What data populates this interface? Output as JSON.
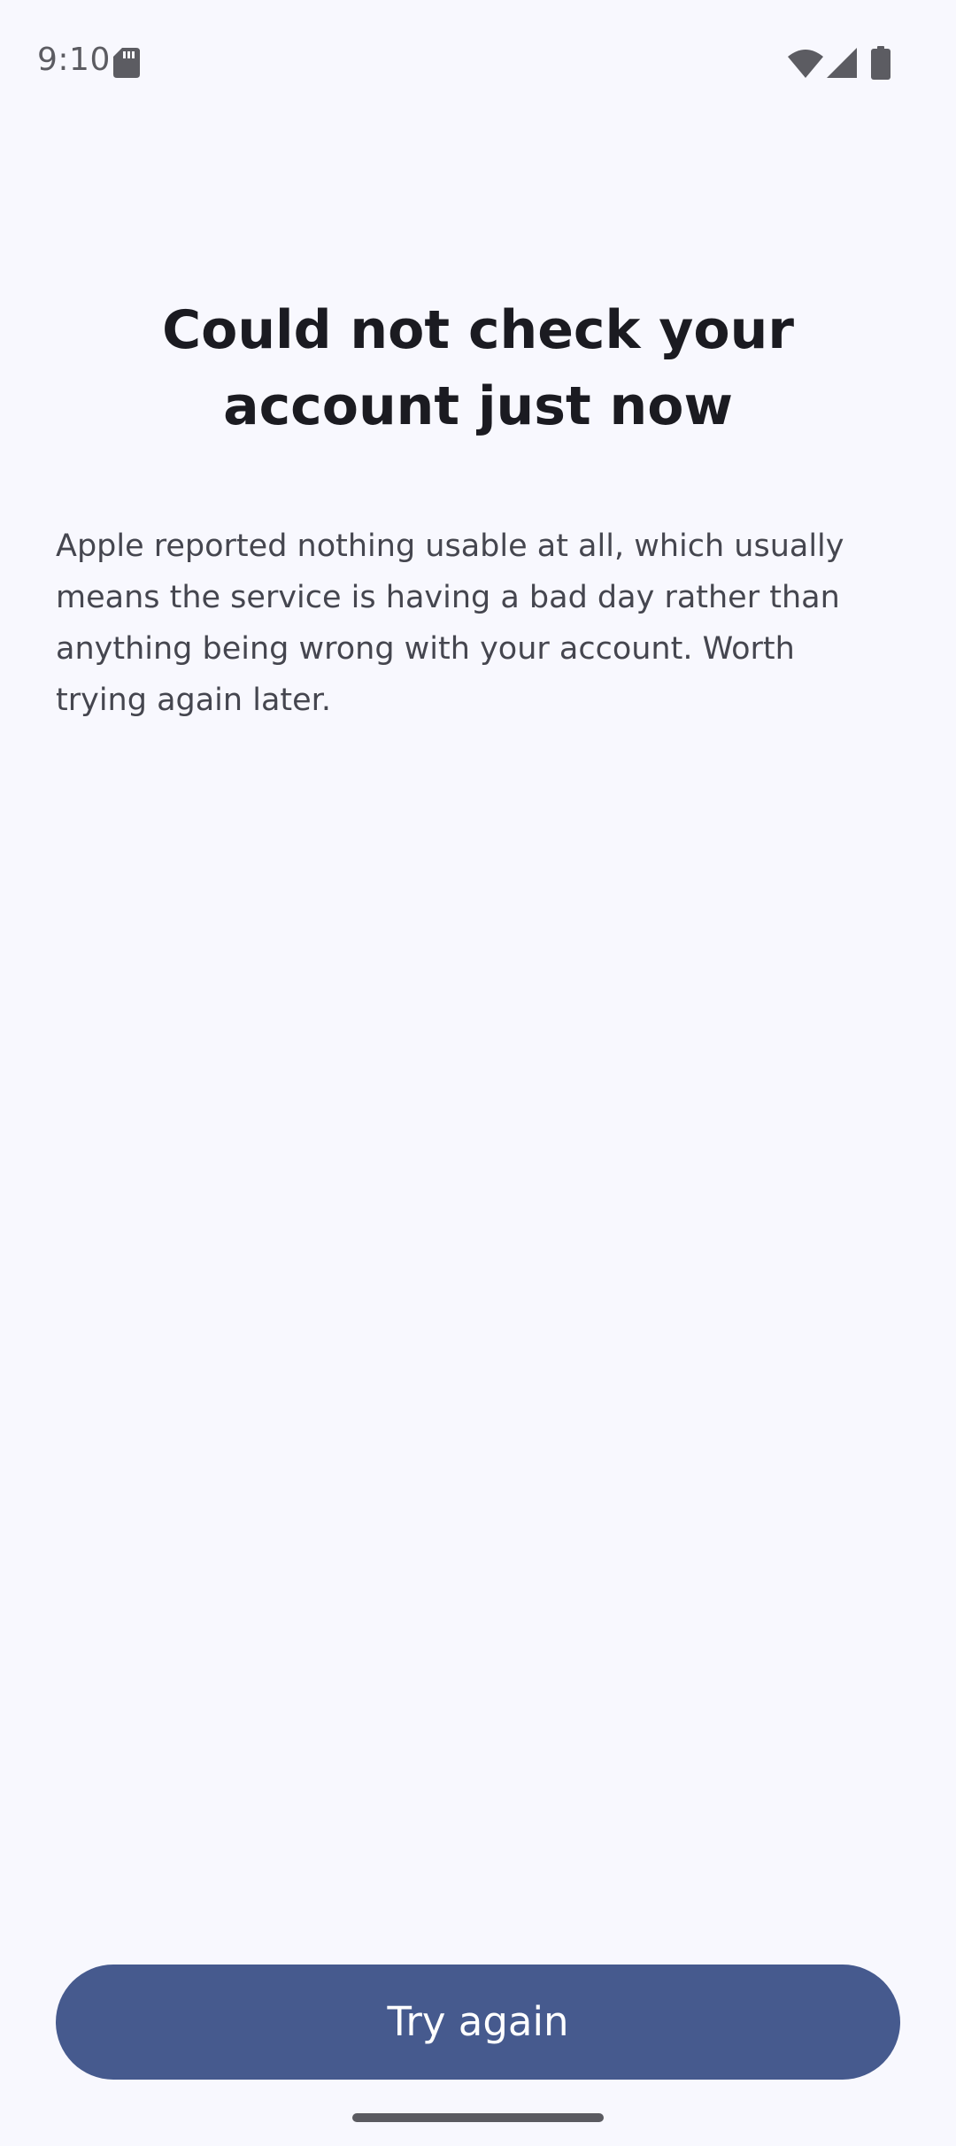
{
  "status_bar": {
    "time": "9:10",
    "icons": [
      "sd-card-icon",
      "wifi-icon",
      "cell-signal-icon",
      "battery-icon"
    ],
    "icon_color": "#5C5C62"
  },
  "main": {
    "title": "Could not check your account just now",
    "body": "Apple reported nothing usable at all, which usually means the service is having a bad day rather than anything being wrong with your account. Worth trying again later."
  },
  "actions": {
    "try_again_label": "Try again"
  },
  "colors": {
    "background": "#F8F8FE",
    "title": "#1B1B21",
    "body_text": "#45464F",
    "button_bg": "#465A8E",
    "button_text": "#FFFFFF",
    "nav_handle": "#5B5B61"
  }
}
